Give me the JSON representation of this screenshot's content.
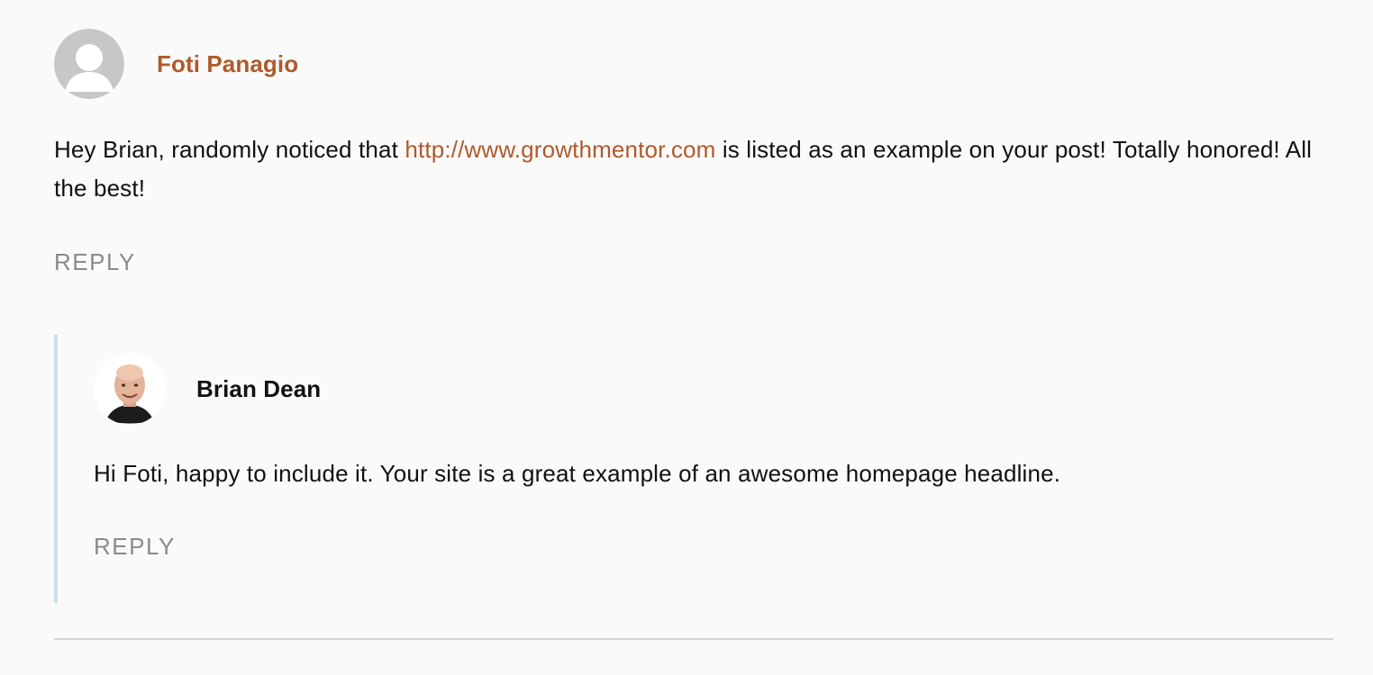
{
  "comments": [
    {
      "author": "Foti Panagio",
      "avatar_icon": "default-user-icon",
      "text_before_link": "Hey Brian, randomly noticed that ",
      "link_text": "http://www.growthmentor.com",
      "text_after_link": " is listed as an example on your post! Totally honored! All the best!",
      "reply_label": "REPLY"
    }
  ],
  "replies": [
    {
      "author": "Brian Dean",
      "avatar_icon": "profile-photo-icon",
      "text": "Hi Foti, happy to include it. Your site is a great example of an awesome homepage headline.",
      "reply_label": "REPLY"
    }
  ],
  "colors": {
    "accent": "#b05a2c",
    "reply_label": "#8a8a8a",
    "thread_line": "#c9e1ea",
    "divider": "#d4d4d4",
    "background": "#fafafa"
  }
}
